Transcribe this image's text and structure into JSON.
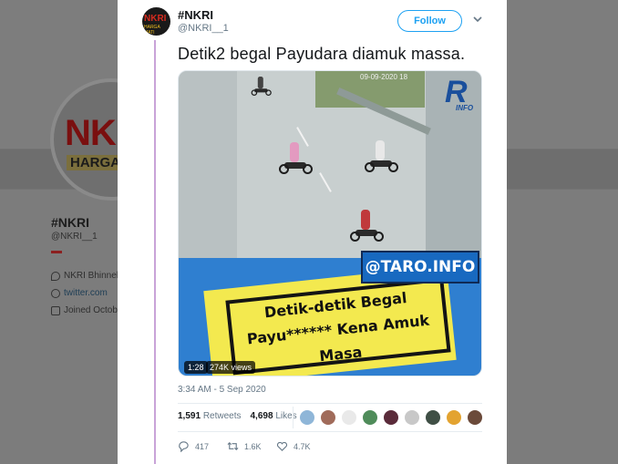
{
  "background_profile": {
    "avatar_text_top": "NKRI",
    "avatar_text_bottom": "HARGA",
    "display_name": "#NKRI",
    "handle": "@NKRI__1",
    "location": "NKRI Bhinnek",
    "website": "twitter.com",
    "joined": "Joined Octobe"
  },
  "tweet": {
    "author": {
      "display_name": "#NKRI",
      "handle": "@NKRI__1",
      "avatar_text": "NKRI",
      "avatar_subtext": "HARGA MATI"
    },
    "follow_label": "Follow",
    "text": "Detik2 begal Payudara diamuk massa.",
    "media": {
      "video_timestamp": "09-09-2020 18",
      "watermark_logo": "R",
      "watermark_sub": "INFO",
      "site_tag": "@TARO.INFO",
      "caption_line1": "Detik-detik Begal",
      "caption_line2": "Payu****** Kena Amuk",
      "caption_line3": "Masa",
      "duration": "1:28",
      "views": "274K views"
    },
    "time": "3:34 AM - 5 Sep 2020",
    "retweets_count": "1,591",
    "retweets_label": "Retweets",
    "likes_count": "4,698",
    "likes_label": "Likes",
    "liker_colors": [
      "#8fb6d8",
      "#a06b5a",
      "#e9e9e9",
      "#4f8c5a",
      "#5a2b3a",
      "#c8c8c8",
      "#3f4f45",
      "#e3a330",
      "#6b4a3a"
    ],
    "actions": {
      "replies": "417",
      "retweets": "1.6K",
      "likes": "4.7K"
    }
  }
}
